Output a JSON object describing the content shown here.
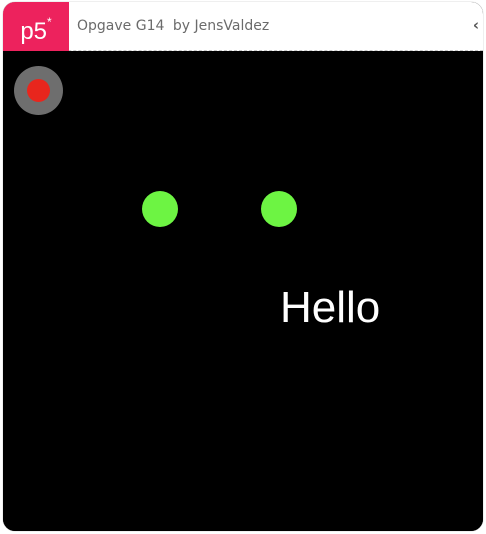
{
  "header": {
    "logo_text": "p5",
    "logo_mark": "*",
    "sketch_name": "Opgave G14",
    "author_line": "by JensValdez",
    "collapse_icon": "chevron-left-icon",
    "brand_color": "#ED225D"
  },
  "canvas": {
    "background": "#000000",
    "text": "Hello",
    "circle_color": "#6df443",
    "record_button_color": "#e8261d"
  }
}
